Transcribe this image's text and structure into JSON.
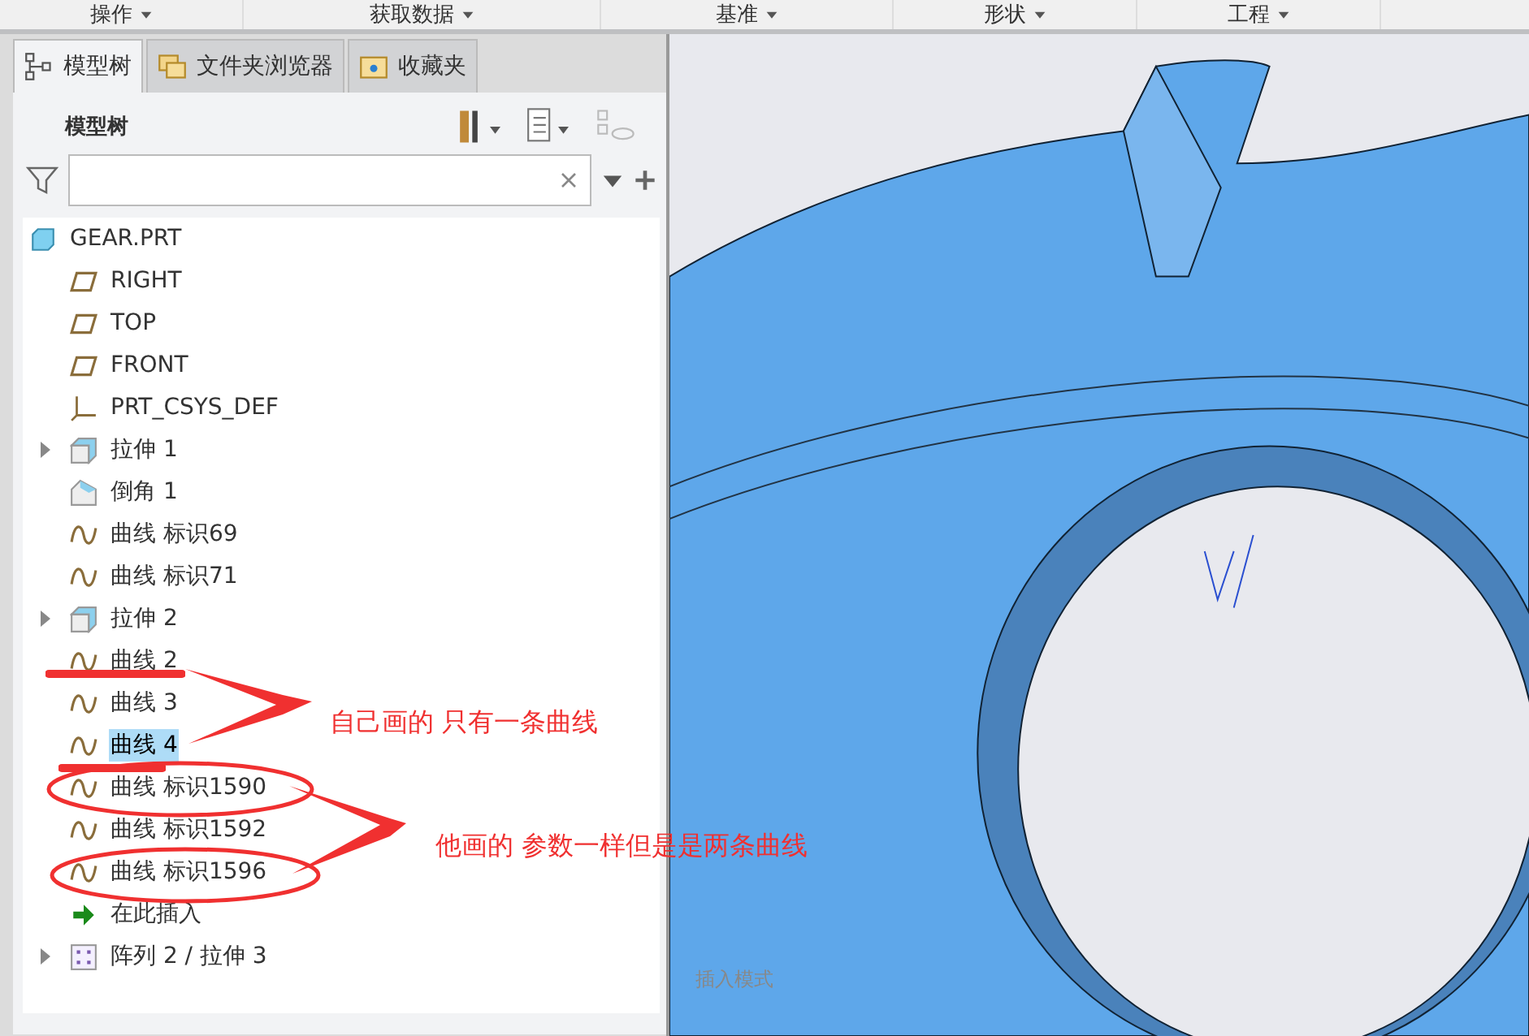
{
  "menu_bar": [
    "操作",
    "获取数据",
    "基准",
    "形状",
    "工程"
  ],
  "tabs": [
    {
      "label": "模型树",
      "selected": true,
      "kind": "tree"
    },
    {
      "label": "文件夹浏览器",
      "selected": false,
      "kind": "folders"
    },
    {
      "label": "收藏夹",
      "selected": false,
      "kind": "favorites"
    }
  ],
  "panel_title": "模型树",
  "tree": [
    {
      "label": "GEAR.PRT",
      "kind": "part",
      "selected": false,
      "children": [
        {
          "label": "RIGHT",
          "kind": "plane",
          "selected": false
        },
        {
          "label": "TOP",
          "kind": "plane",
          "selected": false
        },
        {
          "label": "FRONT",
          "kind": "plane",
          "selected": false
        },
        {
          "label": "PRT_CSYS_DEF",
          "kind": "csys",
          "selected": false
        },
        {
          "label": "拉伸 1",
          "kind": "extrude",
          "selected": false,
          "expanded": false
        },
        {
          "label": "倒角 1",
          "kind": "chamfer",
          "selected": false
        },
        {
          "label": "曲线 标识69",
          "kind": "curve",
          "selected": false
        },
        {
          "label": "曲线 标识71",
          "kind": "curve",
          "selected": false
        },
        {
          "label": "拉伸 2",
          "kind": "extrude",
          "selected": false,
          "expanded": false
        },
        {
          "label": "曲线 2",
          "kind": "curve",
          "selected": false
        },
        {
          "label": "曲线 3",
          "kind": "curve",
          "selected": false
        },
        {
          "label": "曲线 4",
          "kind": "curve",
          "selected": true
        },
        {
          "label": "曲线 标识1590",
          "kind": "curve",
          "selected": false
        },
        {
          "label": "曲线 标识1592",
          "kind": "curve",
          "selected": false
        },
        {
          "label": "曲线 标识1596",
          "kind": "curve",
          "selected": false
        },
        {
          "label": "在此插入",
          "kind": "insert",
          "selected": false
        },
        {
          "label": "阵列 2 / 拉伸 3",
          "kind": "pattern",
          "selected": false,
          "expanded": false
        }
      ]
    }
  ],
  "annotations": [
    "自己画的 只有一条曲线",
    "他画的 参数一样但是是两条曲线"
  ],
  "viewport": {
    "status": "插入模式"
  }
}
